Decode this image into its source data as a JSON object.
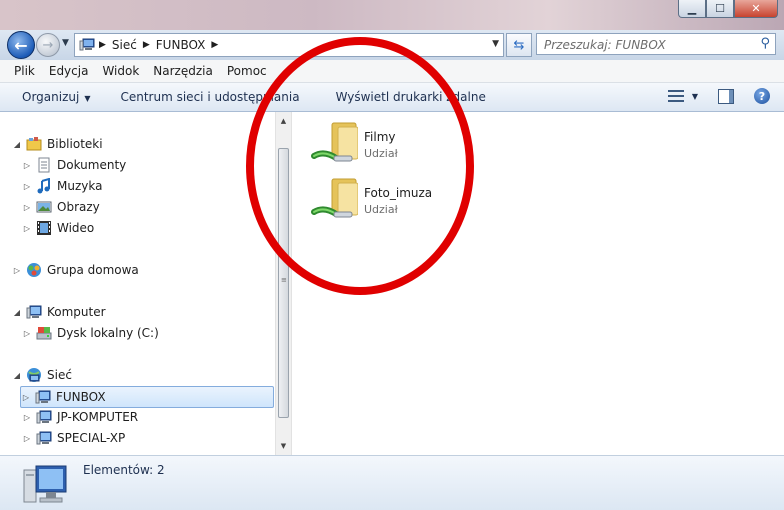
{
  "window": {
    "controls": [
      "minimize",
      "maximize",
      "close"
    ]
  },
  "address_bar": {
    "crumbs": [
      "Sieć",
      "FUNBOX"
    ]
  },
  "search": {
    "placeholder": "Przeszukaj: FUNBOX"
  },
  "menu": {
    "items": [
      "Plik",
      "Edycja",
      "Widok",
      "Narzędzia",
      "Pomoc"
    ]
  },
  "commands": {
    "organize": "Organizuj",
    "network_center": "Centrum sieci i udostępniania",
    "printers": "Wyświetl drukarki zdalne"
  },
  "nav_tree": [
    {
      "label": "Biblioteki",
      "icon": "libraries-icon",
      "level": 0,
      "expanded": true
    },
    {
      "label": "Dokumenty",
      "icon": "documents-icon",
      "level": 1,
      "expanded": false
    },
    {
      "label": "Muzyka",
      "icon": "music-icon",
      "level": 1,
      "expanded": false
    },
    {
      "label": "Obrazy",
      "icon": "pictures-icon",
      "level": 1,
      "expanded": false
    },
    {
      "label": "Wideo",
      "icon": "video-icon",
      "level": 1,
      "expanded": false
    },
    {
      "label": "Grupa domowa",
      "icon": "homegroup-icon",
      "level": 0,
      "expanded": false
    },
    {
      "label": "Komputer",
      "icon": "computer-icon",
      "level": 0,
      "expanded": true
    },
    {
      "label": "Dysk lokalny (C:)",
      "icon": "local-disk-icon",
      "level": 1,
      "expanded": false
    },
    {
      "label": "Sieć",
      "icon": "network-icon",
      "level": 0,
      "expanded": true
    },
    {
      "label": "FUNBOX",
      "icon": "network-computer-icon",
      "level": 1,
      "expanded": false,
      "selected": true
    },
    {
      "label": "JP-KOMPUTER",
      "icon": "network-computer-icon",
      "level": 1,
      "expanded": false
    },
    {
      "label": "SPECIAL-XP",
      "icon": "network-computer-icon",
      "level": 1,
      "expanded": false
    }
  ],
  "shares": [
    {
      "name": "Filmy",
      "type": "Udział"
    },
    {
      "name": "Foto_imuza",
      "type": "Udział"
    }
  ],
  "status": {
    "count_text": "Elementów: 2"
  },
  "annotation": {
    "color": "#e00000"
  }
}
